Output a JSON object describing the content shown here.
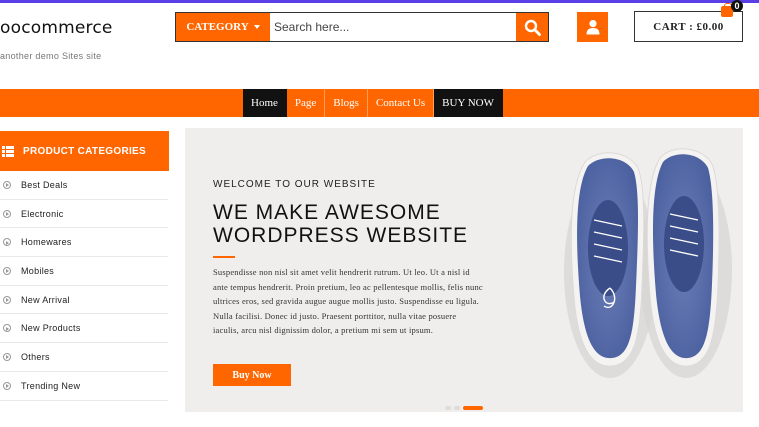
{
  "site": {
    "brand": "oocommerce",
    "tagline": "another demo Sites site"
  },
  "search": {
    "category_label": "CATEGORY",
    "placeholder": "Search here..."
  },
  "cart": {
    "label": "CART : £0.00",
    "count": "0"
  },
  "nav": {
    "items": [
      {
        "label": "Home"
      },
      {
        "label": "Page"
      },
      {
        "label": "Blogs"
      },
      {
        "label": "Contact Us"
      },
      {
        "label": "BUY NOW"
      }
    ]
  },
  "categories": {
    "heading": "PRODUCT CATEGORIES",
    "items": [
      {
        "label": "Best Deals"
      },
      {
        "label": "Electronic"
      },
      {
        "label": "Homewares"
      },
      {
        "label": "Mobiles"
      },
      {
        "label": "New Arrival"
      },
      {
        "label": "New Products"
      },
      {
        "label": "Others"
      },
      {
        "label": "Trending New"
      }
    ]
  },
  "hero": {
    "kicker": "WELCOME TO OUR WEBSITE",
    "title": "WE MAKE AWESOME WORDPRESS WEBSITE",
    "body": "Suspendisse non nisl sit amet velit hendrerit rutrum. Ut leo. Ut a nisl id ante tempus hendrerit. Proin pretium, leo ac pellentesque mollis, felis nunc ultrices eros, sed gravida augue augue mollis justo. Suspendisse eu ligula. Nulla facilisi. Donec id justo. Praesent porttitor, nulla vitae posuere iaculis, arcu nisl dignissim dolor, a pretium mi sem ut ipsum.",
    "button": "Buy Now"
  },
  "colors": {
    "accent": "#ff6600",
    "top_line": "#5b3fe6",
    "dark": "#111111"
  },
  "icons": {
    "search": "search-icon",
    "user": "user-icon",
    "cart": "shopping-bag-icon",
    "categories": "list-icon",
    "bullet": "circle-arrow-icon"
  }
}
